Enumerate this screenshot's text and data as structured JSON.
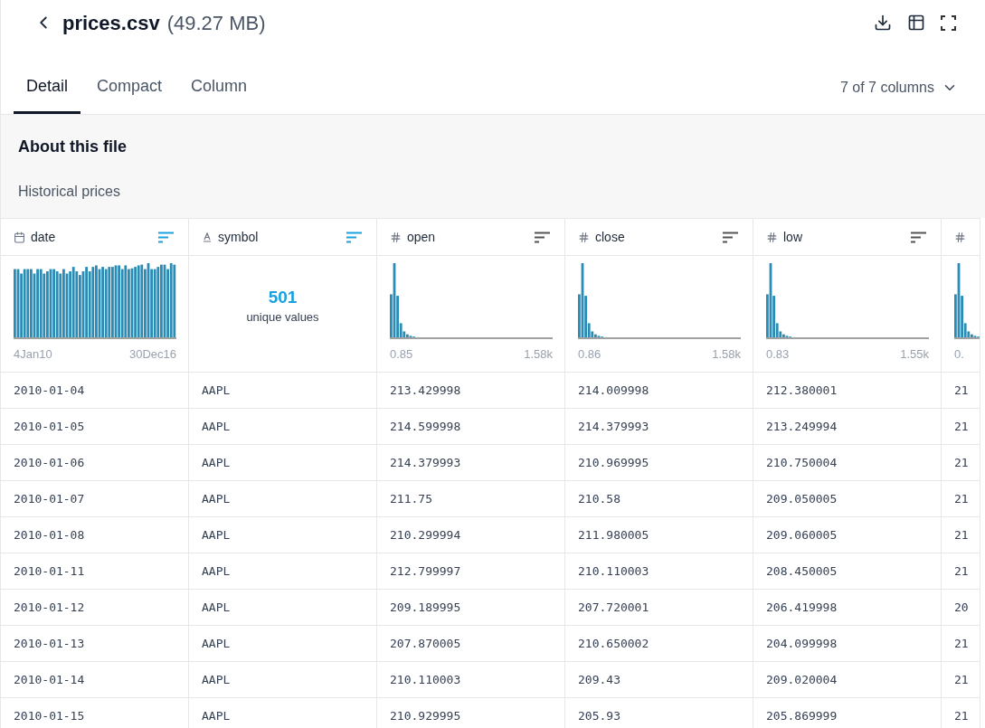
{
  "header": {
    "title": "prices.csv",
    "size": "(49.27 MB)"
  },
  "tabs": [
    {
      "label": "Detail",
      "selected": true
    },
    {
      "label": "Compact",
      "selected": false
    },
    {
      "label": "Column",
      "selected": false
    }
  ],
  "column_picker": "7 of 7 columns",
  "about": {
    "heading": "About this file",
    "description": "Historical prices"
  },
  "columns": [
    {
      "kind": "date",
      "name": "date",
      "sort_active": true,
      "summary": {
        "kind": "histogram",
        "min": "4Jan10",
        "max": "30Dec16"
      }
    },
    {
      "kind": "string",
      "name": "symbol",
      "sort_active": true,
      "summary": {
        "kind": "unique",
        "count": "501",
        "label": "unique values"
      }
    },
    {
      "kind": "number",
      "name": "open",
      "sort_active": false,
      "summary": {
        "kind": "histogram",
        "min": "0.85",
        "max": "1.58k"
      }
    },
    {
      "kind": "number",
      "name": "close",
      "sort_active": false,
      "summary": {
        "kind": "histogram",
        "min": "0.86",
        "max": "1.58k"
      }
    },
    {
      "kind": "number",
      "name": "low",
      "sort_active": false,
      "summary": {
        "kind": "histogram",
        "min": "0.83",
        "max": "1.55k"
      }
    },
    {
      "kind": "number",
      "summary": {
        "kind": "histogram",
        "min": "0."
      }
    }
  ],
  "rows": [
    [
      "2010-01-04",
      "AAPL",
      "213.429998",
      "214.009998",
      "212.380001",
      "21"
    ],
    [
      "2010-01-05",
      "AAPL",
      "214.599998",
      "214.379993",
      "213.249994",
      "21"
    ],
    [
      "2010-01-06",
      "AAPL",
      "214.379993",
      "210.969995",
      "210.750004",
      "21"
    ],
    [
      "2010-01-07",
      "AAPL",
      "211.75",
      "210.58",
      "209.050005",
      "21"
    ],
    [
      "2010-01-08",
      "AAPL",
      "210.299994",
      "211.980005",
      "209.060005",
      "21"
    ],
    [
      "2010-01-11",
      "AAPL",
      "212.799997",
      "210.110003",
      "208.450005",
      "21"
    ],
    [
      "2010-01-12",
      "AAPL",
      "209.189995",
      "207.720001",
      "206.419998",
      "20"
    ],
    [
      "2010-01-13",
      "AAPL",
      "207.870005",
      "210.650002",
      "204.099998",
      "21"
    ],
    [
      "2010-01-14",
      "AAPL",
      "210.110003",
      "209.43",
      "209.020004",
      "21"
    ],
    [
      "2010-01-15",
      "AAPL",
      "210.929995",
      "205.93",
      "205.869999",
      "21"
    ]
  ]
}
